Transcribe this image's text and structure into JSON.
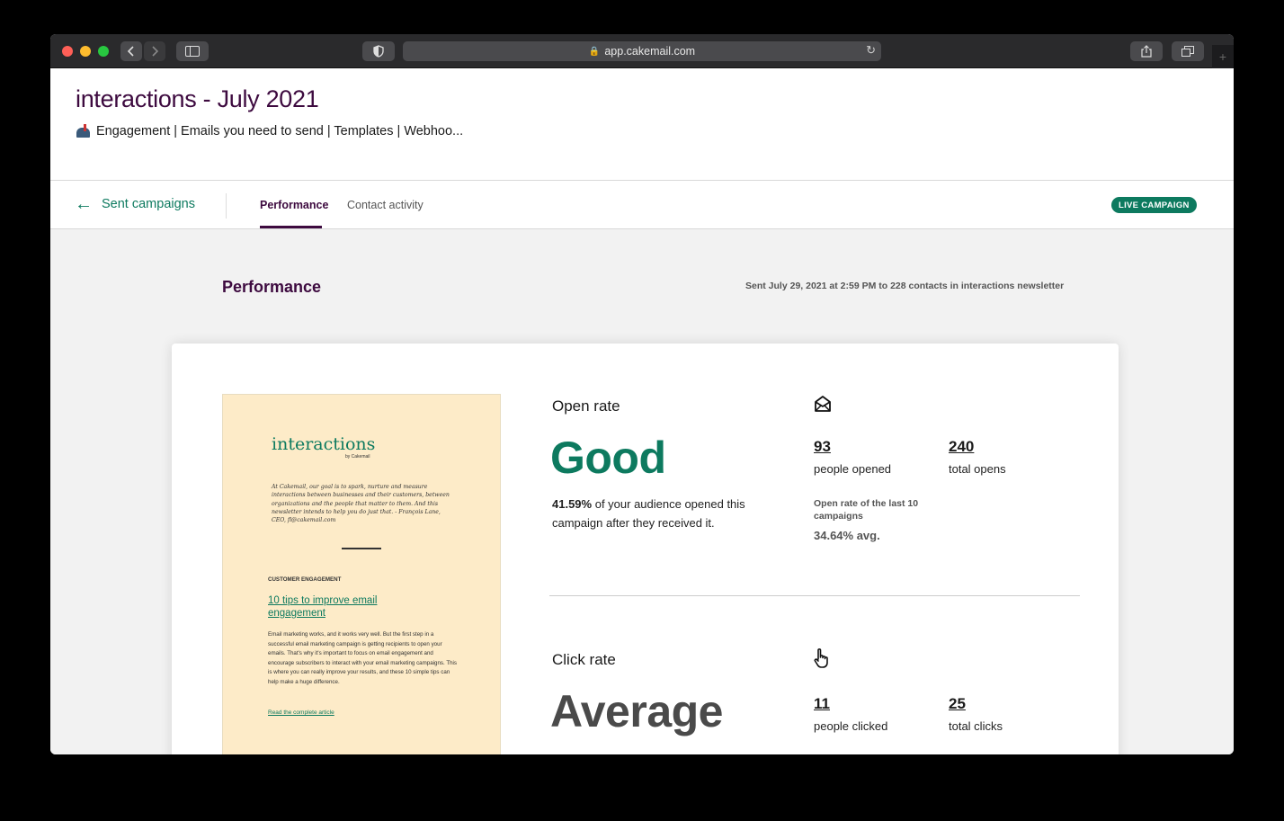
{
  "browser": {
    "url": "app.cakemail.com"
  },
  "header": {
    "title": "interactions - July 2021",
    "subtitle": "Engagement | Emails you need to send | Templates | Webhoo..."
  },
  "tabs": {
    "back_label": "Sent campaigns",
    "items": [
      {
        "label": "Performance",
        "active": true
      },
      {
        "label": "Contact activity",
        "active": false
      }
    ],
    "status_badge": "LIVE CAMPAIGN"
  },
  "performance": {
    "title": "Performance",
    "sent_info": "Sent July 29, 2021 at 2:59 PM to 228 contacts in interactions newsletter"
  },
  "preview": {
    "logo": "interactions",
    "by": "by Cakemail",
    "quote": "At Cakemail, our goal is to spark, nurture and measure interactions between businesses and their customers, between organizations and the people that matter to them. And this newsletter intends to help you do just that. - François Lane, CEO, fl@cakemail.com",
    "category": "CUSTOMER ENGAGEMENT",
    "headline": "10 tips to improve email engagement",
    "body": "Email marketing works, and it works very well. But the first step in a successful email marketing campaign is getting recipients to open your emails. That's why it's important to focus on email engagement and encourage subscribers to interact with your email marketing campaigns. This is where you can really improve your results, and these 10 simple tips can help make a huge difference.",
    "link": "Read the complete article"
  },
  "open_rate": {
    "label": "Open rate",
    "rating": "Good",
    "rating_color": "#0d7a5f",
    "percent": "41.59%",
    "description": "of your audience opened this campaign after they received it.",
    "people_opened": "93",
    "people_opened_label": "people opened",
    "total_opens": "240",
    "total_opens_label": "total opens",
    "avg_label": "Open rate of the last 10 campaigns",
    "avg_value": "34.64% avg.",
    "icon": "envelope-open-icon"
  },
  "click_rate": {
    "label": "Click rate",
    "rating": "Average",
    "rating_color": "#4a4a4a",
    "people_clicked": "11",
    "people_clicked_label": "people clicked",
    "total_clicks": "25",
    "total_clicks_label": "total clicks",
    "icon": "pointer-hand-icon"
  },
  "colors": {
    "brand_purple": "#3d0a3f",
    "brand_green": "#0d7a5f"
  }
}
